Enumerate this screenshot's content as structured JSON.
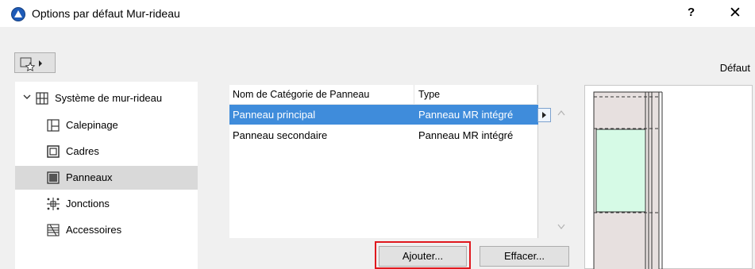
{
  "window": {
    "title": "Options par défaut Mur-rideau",
    "help_label": "?",
    "close_label": "✕"
  },
  "toolbar": {
    "favorites_icon": "favorites-icon",
    "default_label": "Défaut"
  },
  "tree": {
    "root": {
      "label": "Système de mur-rideau",
      "icon": "grid-icon",
      "expanded": true
    },
    "items": [
      {
        "label": "Calepinage",
        "icon": "layout-icon",
        "selected": false
      },
      {
        "label": "Cadres",
        "icon": "frame-icon",
        "selected": false
      },
      {
        "label": "Panneaux",
        "icon": "panel-icon",
        "selected": true
      },
      {
        "label": "Jonctions",
        "icon": "junction-icon",
        "selected": false
      },
      {
        "label": "Accessoires",
        "icon": "accessory-icon",
        "selected": false
      }
    ]
  },
  "panel_table": {
    "columns": [
      "Nom de Catégorie de Panneau",
      "Type"
    ],
    "rows": [
      {
        "name": "Panneau principal",
        "type": "Panneau MR intégré",
        "selected": true
      },
      {
        "name": "Panneau secondaire",
        "type": "Panneau MR intégré",
        "selected": false
      }
    ]
  },
  "buttons": {
    "add_label": "Ajouter...",
    "delete_label": "Effacer..."
  },
  "colors": {
    "selection": "#3f8cdb",
    "highlight_border": "#e0181e",
    "panel_fill": "#d6fae6",
    "frame_fill": "#e7e0df"
  }
}
